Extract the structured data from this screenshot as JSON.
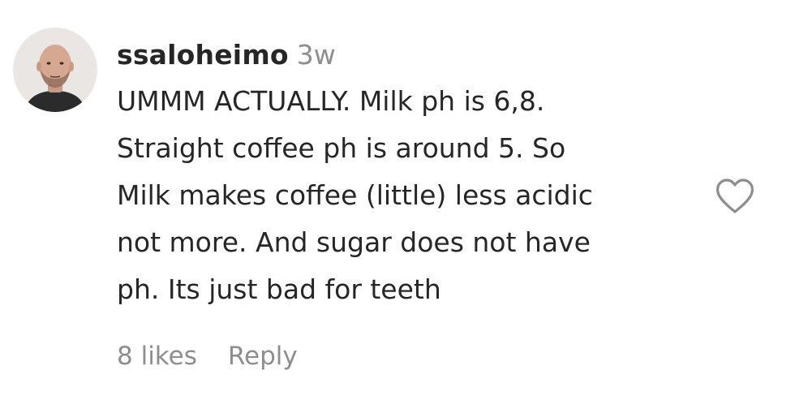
{
  "comment": {
    "username": "ssaloheimo",
    "time_ago": "3w",
    "text_lines": [
      "UMMM ACTUALLY. Milk ph is 6,8.",
      "Straight coffee ph is around 5. So",
      "Milk makes coffee (little) less acidic",
      "not more. And sugar does not have",
      "ph. Its just bad for teeth"
    ],
    "likes_label": "8 likes",
    "reply_label": "Reply",
    "avatar_icon": "profile-photo",
    "like_icon": "heart-outline-icon"
  },
  "colors": {
    "text": "#262626",
    "secondary": "#8e8e8e",
    "background": "#ffffff"
  }
}
